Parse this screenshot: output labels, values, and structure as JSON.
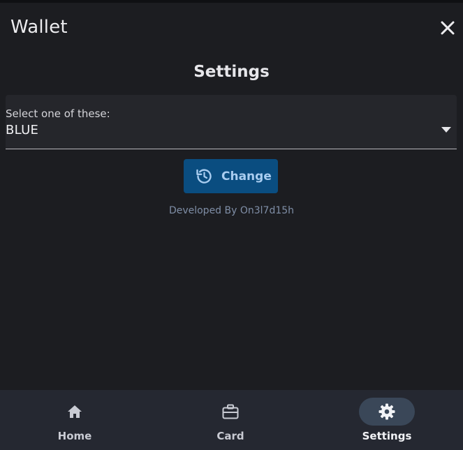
{
  "app": {
    "title": "Wallet"
  },
  "page": {
    "title": "Settings"
  },
  "select": {
    "label": "Select one of these:",
    "value": "BLUE"
  },
  "actions": {
    "change_label": "Change"
  },
  "footer": {
    "credit": "Developed By On3l7d15h"
  },
  "bottom_nav": {
    "items": [
      {
        "label": "Home",
        "icon": "home-icon",
        "active": false
      },
      {
        "label": "Card",
        "icon": "briefcase-icon",
        "active": false
      },
      {
        "label": "Settings",
        "icon": "gear-icon",
        "active": true
      }
    ]
  },
  "colors": {
    "background": "#1c1d21",
    "accent_button": "#0a4d80",
    "accent_button_text": "#a9cdf0",
    "nav_background": "#252831",
    "nav_active_pill": "#3a4758"
  }
}
